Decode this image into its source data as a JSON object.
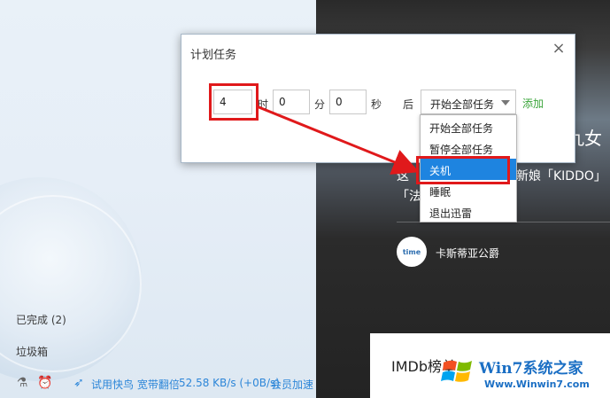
{
  "left_nav": {
    "completed_label": "已完成 (2)",
    "trash_label": "垃圾箱"
  },
  "statusbar": {
    "lab_icon": "flask-icon",
    "alarm_icon": "alarm-clock-icon",
    "bird_icon": "bird-icon",
    "speedup_text": "试用快鸟 宽带翻倍",
    "speed_text": "52.58 KB/s (+0B/s)",
    "vip_text": "会员加速"
  },
  "cover": {
    "title_fragment": "九女",
    "desc_line1_a": "这",
    "desc_line1_b": "新娘「KIDDO」",
    "desc_line2": "「法",
    "author_avatar_text": "time",
    "author_name": "卡斯蒂亚公爵",
    "imdb_title": "IMDb榜单"
  },
  "dialog": {
    "title": "计划任务",
    "hours_value": "4",
    "hours_unit": "时",
    "minutes_value": "0",
    "minutes_unit": "分",
    "seconds_value": "0",
    "seconds_unit": "秒",
    "after_label": "后",
    "action_selected": "开始全部任务",
    "add_label": "添加",
    "close_icon": "close-icon"
  },
  "dropdown": {
    "options": [
      "开始全部任务",
      "暂停全部任务",
      "关机",
      "睡眠",
      "退出迅雷"
    ],
    "selected_index": 2
  },
  "watermark": {
    "logo_text": "Win7系统之家",
    "url_text": "Www.Winwin7.com"
  },
  "colors": {
    "accent_blue": "#1e84e0",
    "annotation_red": "#e0191b",
    "add_green": "#3aa53a",
    "status_link_blue": "#2d86d8"
  }
}
